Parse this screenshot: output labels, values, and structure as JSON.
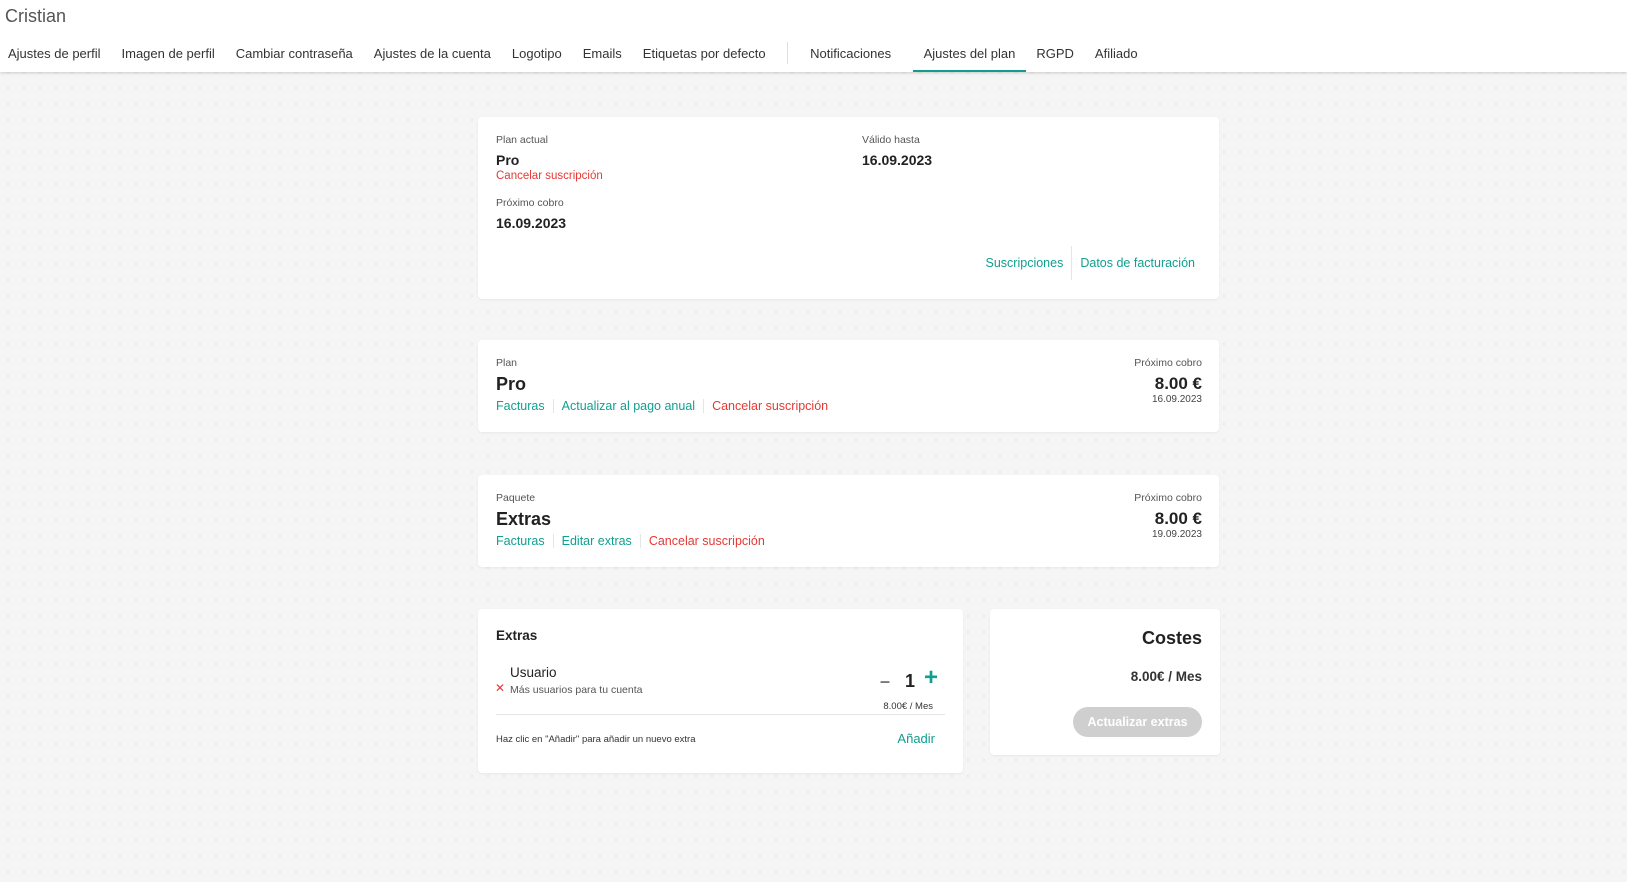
{
  "user": {
    "name": "Cristian"
  },
  "tabs": [
    "Ajustes de perfil",
    "Imagen de perfil",
    "Cambiar contraseña",
    "Ajustes de la cuenta",
    "Logotipo",
    "Emails",
    "Etiquetas por defecto",
    "Notificaciones",
    "Ajustes del plan",
    "RGPD",
    "Afiliado"
  ],
  "active_tab": "Ajustes del plan",
  "summary": {
    "current_plan_label": "Plan actual",
    "current_plan": "Pro",
    "cancel_label": "Cancelar suscripción",
    "valid_until_label": "Válido hasta",
    "valid_until": "16.09.2023",
    "next_charge_label": "Próximo cobro",
    "next_charge": "16.09.2023",
    "subscriptions_link": "Suscripciones",
    "billing_link": "Datos de facturación"
  },
  "plan_card": {
    "label": "Plan",
    "name": "Pro",
    "invoices_link": "Facturas",
    "upgrade_link": "Actualizar al pago anual",
    "cancel_link": "Cancelar suscripción",
    "next_charge_label": "Próximo cobro",
    "amount": "8.00 €",
    "date": "16.09.2023"
  },
  "package_card": {
    "label": "Paquete",
    "name": "Extras",
    "invoices_link": "Facturas",
    "edit_link": "Editar extras",
    "cancel_link": "Cancelar suscripción",
    "next_charge_label": "Próximo cobro",
    "amount": "8.00 €",
    "date": "19.09.2023"
  },
  "extras_card": {
    "title": "Extras",
    "item": {
      "name": "Usuario",
      "description": "Más usuarios para tu cuenta",
      "remove_glyph": "✕",
      "minus_glyph": "–",
      "quantity": "1",
      "plus_glyph": "+",
      "price": "8.00€ / Mes"
    },
    "hint": "Haz clic en \"Añadir\" para añadir un nuevo extra",
    "add_link": "Añadir"
  },
  "costs_card": {
    "title": "Costes",
    "amount": "8.00€ / Mes",
    "update_button": "Actualizar extras"
  },
  "colors": {
    "accent": "#10a090",
    "danger": "#e53935",
    "disabled": "#cfcfcf"
  }
}
